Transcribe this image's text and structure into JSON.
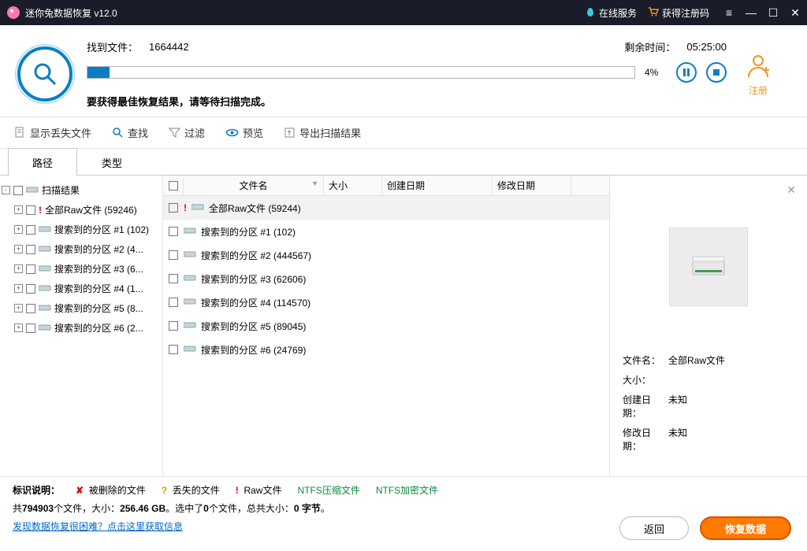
{
  "title": "迷你兔数据恢复 v12.0",
  "header_links": {
    "online": "在线服务",
    "regcode": "获得注册码"
  },
  "scan": {
    "found_label": "找到文件：",
    "found_count": "1664442",
    "remain_label": "剩余时间：",
    "remain_time": "05:25:00",
    "percent": "4%",
    "tip": "要获得最佳恢复结果，请等待扫描完成。",
    "register": "注册"
  },
  "toolbar": {
    "show_lost": "显示丢失文件",
    "find": "查找",
    "filter": "过滤",
    "preview": "预览",
    "export": "导出扫描结果"
  },
  "tabs": {
    "path": "路径",
    "type": "类型"
  },
  "tree": {
    "root": "扫描结果",
    "items": [
      "全部Raw文件 (59246)",
      "搜索到的分区 #1 (102)",
      "搜索到的分区 #2 (4...",
      "搜索到的分区 #3 (6...",
      "搜索到的分区 #4 (1...",
      "搜索到的分区 #5 (8...",
      "搜索到的分区 #6 (2..."
    ]
  },
  "columns": {
    "name": "文件名",
    "size": "大小",
    "cdate": "创建日期",
    "mdate": "修改日期"
  },
  "rows": [
    "全部Raw文件 (59244)",
    "搜索到的分区 #1 (102)",
    "搜索到的分区 #2 (444567)",
    "搜索到的分区 #3 (62606)",
    "搜索到的分区 #4 (114570)",
    "搜索到的分区 #5 (89045)",
    "搜索到的分区 #6 (24769)"
  ],
  "preview": {
    "fname_k": "文件名：",
    "fname_v": "全部Raw文件",
    "size_k": "大小：",
    "size_v": "",
    "cdate_k": "创建日期：",
    "cdate_v": "未知",
    "mdate_k": "修改日期：",
    "mdate_v": "未知"
  },
  "legend": {
    "label": "标识说明：",
    "deleted": "被删除的文件",
    "lost": "丢失的文件",
    "raw": "Raw文件",
    "ntfs_comp": "NTFS压缩文件",
    "ntfs_enc": "NTFS加密文件"
  },
  "stats": {
    "p1": "共",
    "p2": "794903",
    "p3": "个文件，大小：",
    "p4": "256.46 GB",
    "p5": "。选中了",
    "p6": "0",
    "p7": "个文件，总共大小：",
    "p8": "0 字节",
    "p9": "。"
  },
  "help": "发现数据恢复很困难？点击这里获取信息",
  "buttons": {
    "back": "返回",
    "recover": "恢复数据"
  }
}
